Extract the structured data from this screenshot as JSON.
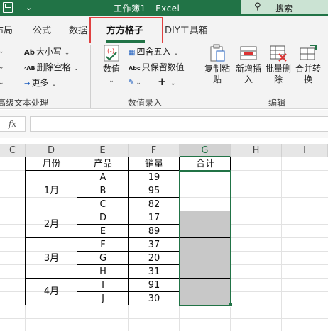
{
  "titlebar": {
    "title": "工作簿1  -  Excel",
    "search_label": "搜索",
    "qat_arrow": "⌄"
  },
  "tabs": [
    {
      "label": "布局",
      "active": false
    },
    {
      "label": "公式",
      "active": false
    },
    {
      "label": "数据",
      "active": false
    },
    {
      "label": "方方格子",
      "active": true
    },
    {
      "label": "DIY工具箱",
      "active": false
    }
  ],
  "ribbon": {
    "text_group": {
      "items": [
        "大小写",
        "删除空格",
        "更多"
      ],
      "label": "高级文本处理"
    },
    "number_group": {
      "big_button": "数值",
      "items": [
        "四舍五入",
        "只保留数值"
      ],
      "label": "数值录入"
    },
    "edit_group": {
      "buttons": [
        "复制粘贴",
        "新增插入",
        "批量删除",
        "合并转换"
      ],
      "label": "编辑"
    }
  },
  "formula_bar": {
    "fx": "fx",
    "value": ""
  },
  "columns": [
    "C",
    "D",
    "E",
    "F",
    "G",
    "H",
    "I"
  ],
  "selected_column": "G",
  "table": {
    "headers": {
      "month": "月份",
      "product": "产品",
      "sales": "销量",
      "total": "合计"
    },
    "months": [
      "1月",
      "2月",
      "3月",
      "4月"
    ],
    "rows": [
      {
        "product": "A",
        "sales": "19"
      },
      {
        "product": "B",
        "sales": "95"
      },
      {
        "product": "C",
        "sales": "82"
      },
      {
        "product": "D",
        "sales": "17"
      },
      {
        "product": "E",
        "sales": "89"
      },
      {
        "product": "F",
        "sales": "37"
      },
      {
        "product": "G",
        "sales": "20"
      },
      {
        "product": "H",
        "sales": "31"
      },
      {
        "product": "I",
        "sales": "91"
      },
      {
        "product": "J",
        "sales": "30"
      }
    ]
  },
  "colors": {
    "accent": "#217346",
    "highlight": "#e04040",
    "merged_fill": "#c8c8c8"
  }
}
